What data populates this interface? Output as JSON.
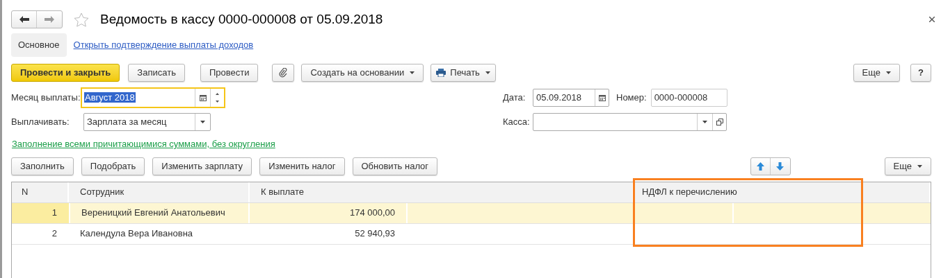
{
  "window": {
    "title": "Ведомость в кассу 0000-000008 от 05.09.2018"
  },
  "nav_tabs": [
    {
      "label": "Основное",
      "selected": true
    },
    {
      "label": "Открыть подтверждение выплаты доходов",
      "selected": false
    }
  ],
  "toolbar": [
    {
      "kind": "primary",
      "label": "Провести и закрыть"
    },
    {
      "kind": "plain",
      "label": "Записать"
    },
    {
      "kind": "plain",
      "label": "Провести"
    },
    {
      "kind": "clip"
    },
    {
      "kind": "menu",
      "label": "Создать на основании"
    },
    {
      "kind": "print",
      "label": "Печать"
    }
  ],
  "toolbar_right": {
    "more": "Еще",
    "help": "?"
  },
  "fields": {
    "month": {
      "label": "Месяц выплаты:",
      "value": "Август 2018"
    },
    "pay": {
      "label": "Выплачивать:",
      "value": "Зарплата за месяц"
    },
    "date": {
      "label": "Дата:",
      "value": "05.09.2018"
    },
    "number": {
      "label": "Номер:",
      "value": "0000-000008"
    },
    "cash": {
      "label": "Касса:"
    }
  },
  "fill_link": "Заполнение всеми причитающимися суммами, без округления",
  "table_toolbar": [
    "Заполнить",
    "Подобрать",
    "Изменить зарплату",
    "Изменить налог",
    "Обновить налог"
  ],
  "table_more": "Еще",
  "table": {
    "columns": [
      "N",
      "Сотрудник",
      "К выплате",
      "НДФЛ к перечислению"
    ],
    "rows": [
      {
        "n": "1",
        "employee": "Вереницкий Евгений Анатольевич",
        "amount": "174 000,00",
        "selected": true
      },
      {
        "n": "2",
        "employee": "Календула Вера Ивановна",
        "amount": "52 940,93",
        "selected": false
      }
    ]
  }
}
